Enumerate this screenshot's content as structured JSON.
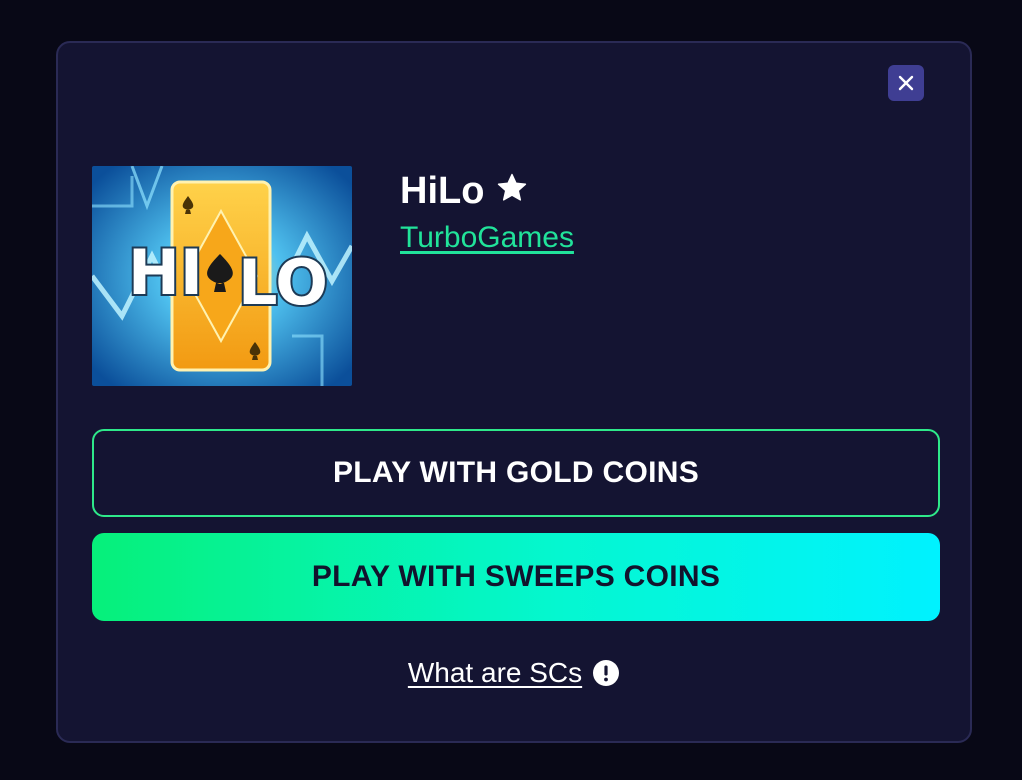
{
  "modal": {
    "close_icon": "close-icon",
    "game": {
      "title": "HiLo",
      "favorite_icon": "star-icon",
      "provider": "TurboGames",
      "thumbnail": {
        "logo_text": "HiLo",
        "accent_color": "#f7b51b",
        "background_color": "#0d6fb5"
      }
    },
    "buttons": {
      "gold_label": "PLAY WITH GOLD COINS",
      "sweeps_label": "PLAY WITH SWEEPS COINS"
    },
    "help": {
      "link_label": "What are SCs",
      "info_icon": "info-icon"
    }
  },
  "colors": {
    "page_background": "#080816",
    "modal_background": "#141432",
    "accent_green": "#21e39a",
    "gradient_start": "#06f07a",
    "gradient_end": "#00f2ff",
    "close_button_background": "#3f3e93"
  }
}
